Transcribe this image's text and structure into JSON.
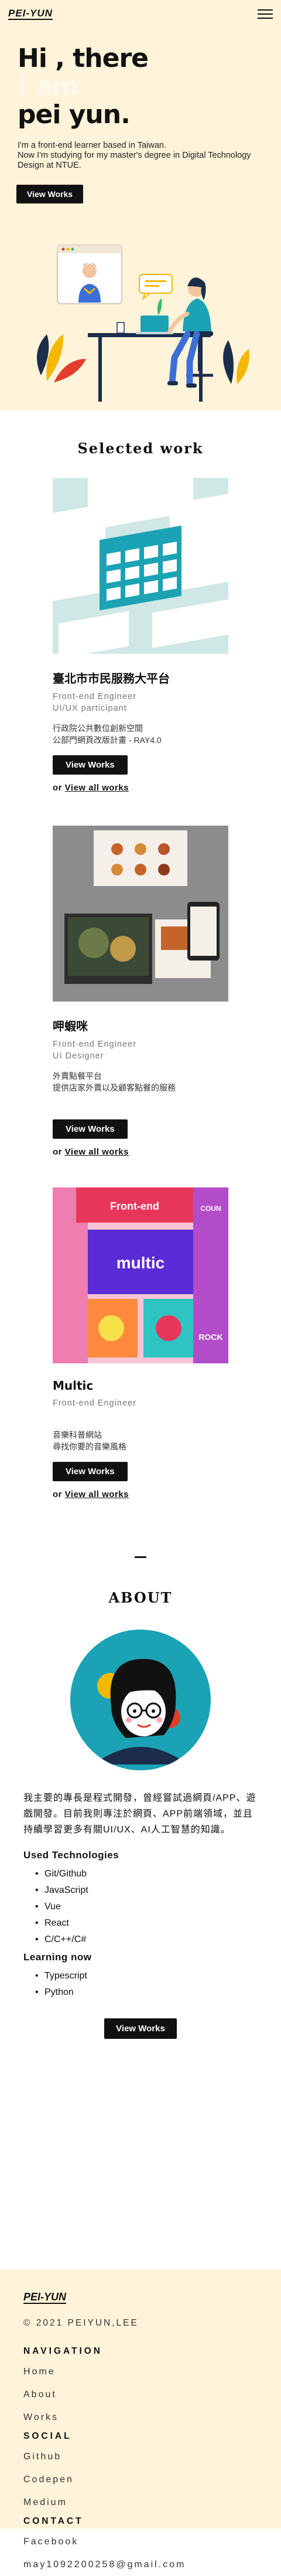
{
  "header": {
    "brand": "PEI-YUN",
    "menu_icon": "hamburger-icon"
  },
  "hero": {
    "line1": "Hi , there",
    "line2": "I am",
    "line3": "pei yun.",
    "desc1": "I'm a front-end learner based in Taiwan.",
    "desc2": "Now I'm studying for my master's degree in Digital Technology Design at NTUE.",
    "cta": "View Works"
  },
  "works": {
    "title": "Selected work",
    "items": [
      {
        "name": "臺北市市民服務大平台",
        "role1": "Front-end Engineer",
        "role2": "UI/UX participant",
        "desc1": "行政院公共數位創新空間",
        "desc2": "公部門網頁改版計畫 - RAY4.0",
        "btn": "View Works",
        "or": "or",
        "more": "View all works"
      },
      {
        "name": "呷蝦咪",
        "role1": "Front-end Engineer",
        "role2": "UI Designer",
        "desc1": "外賣點餐平台",
        "desc2": "提供店家外賣以及顧客點餐的服務",
        "btn": "View Works",
        "or": "or",
        "more": "View all works"
      },
      {
        "name": "Multic",
        "role1": "Front-end Engineer",
        "role2": "",
        "desc1": "音樂科普網站",
        "desc2": "尋找你要的音樂風格",
        "btn": "View Works",
        "or": "or",
        "more": "View all works",
        "img_label_1": "Front-end",
        "img_label_2": "multic",
        "img_label_3": "COUN",
        "img_label_4": "ROCK"
      }
    ]
  },
  "about": {
    "title": "ABOUT",
    "text": "我主要的專長是程式開發，曾經嘗試過網頁/APP、遊戲開發。目前我則專注於網頁、APP前端領域，並且持續學習更多有關UI/UX、AI人工智慧的知識。",
    "used_title": "Used Technologies",
    "used": [
      "Git/Github",
      "JavaScript",
      "Vue",
      "React",
      "C/C++/C#"
    ],
    "learning_title": "Learning now",
    "learning": [
      "Typescript",
      "Python"
    ],
    "cta": "View Works"
  },
  "footer": {
    "brand": "PEI-YUN",
    "copyright": "© 2021 PEIYUN,LEE",
    "nav_title": "NAVIGATION",
    "nav": [
      "Home",
      "About",
      "Works"
    ],
    "social_title": "SOCIAL",
    "social": [
      "Github",
      "Codepen",
      "Medium"
    ],
    "contact_title": "CONTACT",
    "contact": [
      "Facebook",
      "may1092200258@gmail.com"
    ]
  },
  "colors": {
    "cream": "#fff3d9",
    "teal": "#1ba3b5",
    "black": "#111111",
    "yellow": "#f5b800",
    "blue": "#3b6fd8"
  }
}
